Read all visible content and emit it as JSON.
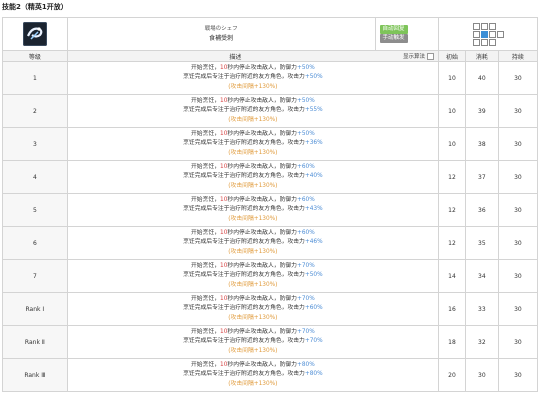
{
  "page_title": "技能2（精英1开放）",
  "skill": {
    "jp_name": "戦場のシェフ",
    "cn_name": "食補受刺",
    "tags": [
      {
        "label": "自动回复",
        "color": "#7ec45a"
      },
      {
        "label": "手动触发",
        "color": "#8d8d8d"
      }
    ],
    "icon": "skill-icon"
  },
  "columns": {
    "level": "等级",
    "desc": "描述",
    "show_algo": "显示算法",
    "init": "初始",
    "cost": "消耗",
    "duration": "持续"
  },
  "desc_text": {
    "l1_a": "开始烹饪，",
    "l1_b": "10",
    "l1_c": "秒内停止攻击敌人，防御力",
    "l2_a": "烹饪完成后专注于治疗附近的友方角色，攻击力",
    "l3": "(攻击间隔+130%)"
  },
  "rows": [
    {
      "level": "1",
      "def": "+50%",
      "atk": "+50%",
      "init": "10",
      "cost": "40",
      "dur": "30"
    },
    {
      "level": "2",
      "def": "+50%",
      "atk": "+55%",
      "init": "10",
      "cost": "39",
      "dur": "30"
    },
    {
      "level": "3",
      "def": "+50%",
      "atk": "+36%",
      "init": "10",
      "cost": "38",
      "dur": "30"
    },
    {
      "level": "4",
      "def": "+60%",
      "atk": "+40%",
      "init": "12",
      "cost": "37",
      "dur": "30"
    },
    {
      "level": "5",
      "def": "+60%",
      "atk": "+43%",
      "init": "12",
      "cost": "36",
      "dur": "30"
    },
    {
      "level": "6",
      "def": "+60%",
      "atk": "+46%",
      "init": "12",
      "cost": "35",
      "dur": "30"
    },
    {
      "level": "7",
      "def": "+70%",
      "atk": "+50%",
      "init": "14",
      "cost": "34",
      "dur": "30"
    },
    {
      "level": "Rank Ⅰ",
      "def": "+70%",
      "atk": "+60%",
      "init": "16",
      "cost": "33",
      "dur": "30"
    },
    {
      "level": "Rank Ⅱ",
      "def": "+70%",
      "atk": "+70%",
      "init": "18",
      "cost": "32",
      "dur": "30"
    },
    {
      "level": "Rank Ⅲ",
      "def": "+80%",
      "atk": "+80%",
      "init": "20",
      "cost": "30",
      "dur": "30"
    }
  ],
  "colors": {
    "highlight_red": "#d64242",
    "highlight_blue": "#4a8bd4",
    "highlight_orange": "#e09a3a",
    "range_self": "#3b8ed6"
  }
}
